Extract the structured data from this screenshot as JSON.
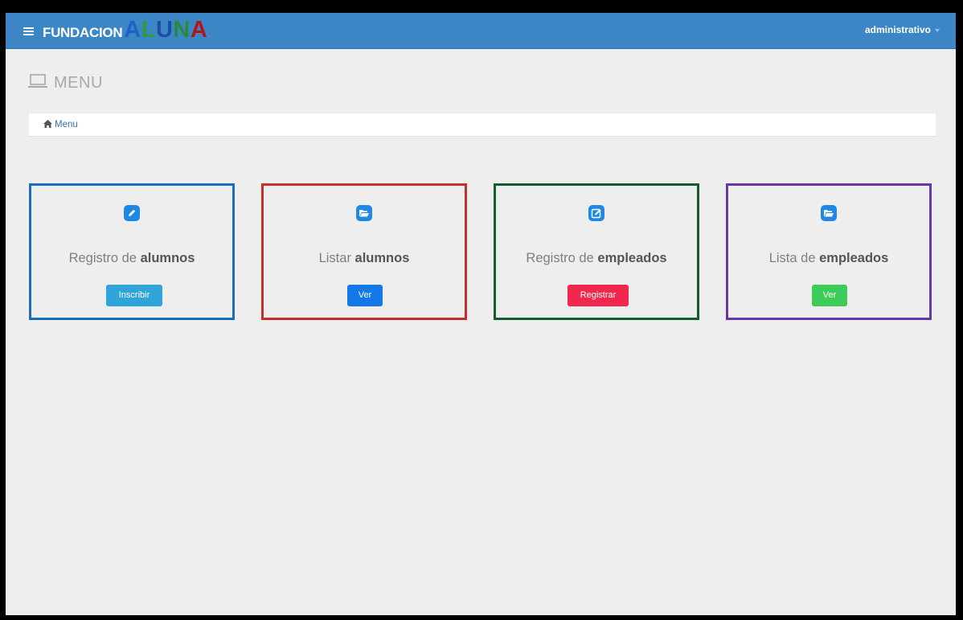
{
  "navbar": {
    "brand_prefix": "FUNDACION",
    "brand_letters": [
      {
        "char": "A",
        "color": "#1e63c4"
      },
      {
        "char": "L",
        "color": "#2e9c3a"
      },
      {
        "char": "U",
        "color": "#1e4fa8"
      },
      {
        "char": "N",
        "color": "#2a8a3a"
      },
      {
        "char": "A",
        "color": "#b01818"
      }
    ],
    "user": "administrativo",
    "menu_icon": "hamburger-icon",
    "colors": {
      "bar": "#3d86c6"
    }
  },
  "header": {
    "icon": "laptop-icon",
    "title": "MENU"
  },
  "breadcrumb": {
    "icon": "home-icon",
    "label": "Menu"
  },
  "cards": [
    {
      "title_prefix": "Registro de",
      "title_bold": "alumnos",
      "button": "Inscribir",
      "icon": "pencil-icon",
      "border_color": "#1a6cbf",
      "icon_color": "#1e88e5",
      "button_color": "#2fa4d9"
    },
    {
      "title_prefix": "Listar",
      "title_bold": "alumnos",
      "button": "Ver",
      "icon": "folder-open-icon",
      "border_color": "#c6302a",
      "icon_color": "#1e88e5",
      "button_color": "#1479e8"
    },
    {
      "title_prefix": "Registro de",
      "title_bold": "empleados",
      "button": "Registrar",
      "icon": "edit-icon",
      "border_color": "#155c2c",
      "icon_color": "#1e88e5",
      "button_color": "#f0284d"
    },
    {
      "title_prefix": "Lista de",
      "title_bold": "empleados",
      "button": "Ver",
      "icon": "folder-open-icon",
      "border_color": "#6836a6",
      "icon_color": "#1e88e5",
      "button_color": "#3dcc5a"
    }
  ]
}
